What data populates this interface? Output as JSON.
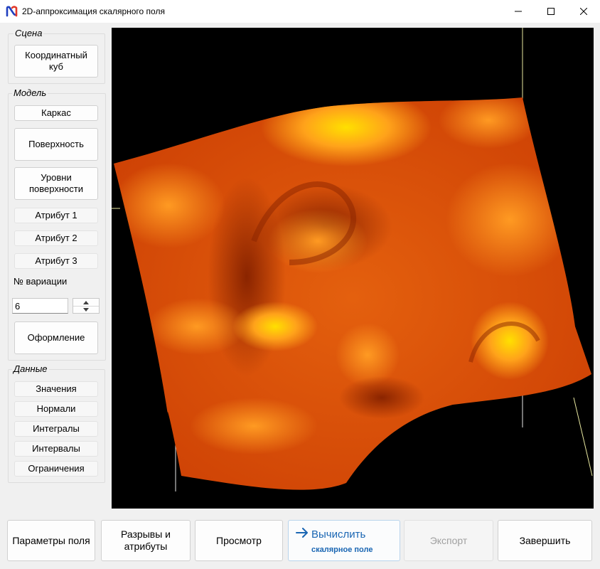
{
  "window": {
    "title": "2D-аппроксимация скалярного поля",
    "icon": "app-logo-icon"
  },
  "scene": {
    "legend": "Сцена",
    "coord_cube": "Координатный куб"
  },
  "model": {
    "legend": "Модель",
    "wireframe": "Каркас",
    "surface": "Поверхность",
    "surface_levels": "Уровни поверхности",
    "attr1": "Атрибут 1",
    "attr2": "Атрибут 2",
    "attr3": "Атрибут 3",
    "variation_label": "№ вариации",
    "variation_value": "6",
    "styling": "Оформление"
  },
  "data_group": {
    "legend": "Данные",
    "values": "Значения",
    "normals": "Нормали",
    "integrals": "Интегралы",
    "intervals": "Интервалы",
    "constraints": "Ограничения"
  },
  "bottom": {
    "field_params": "Параметры поля",
    "breaks_attrs": "Разрывы и атрибуты",
    "preview": "Просмотр",
    "compute_title": "Вычислить",
    "compute_sub": "скалярное поле",
    "export": "Экспорт",
    "finish": "Завершить"
  },
  "colors": {
    "surface_dark": "#b83200",
    "surface_mid": "#e25a0a",
    "surface_light": "#ffa21a",
    "surface_hot": "#ffe000",
    "accent": "#1a66b3"
  }
}
